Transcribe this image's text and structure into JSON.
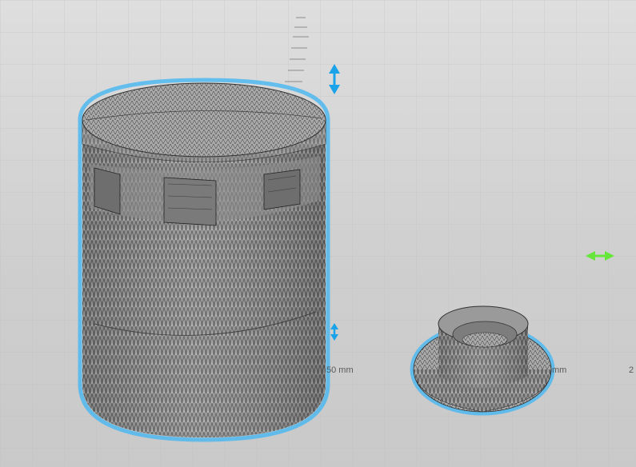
{
  "viewport": {
    "background": "#d6d6d6",
    "model_color": "#9a9a9a",
    "wire_color": "#2b2b2b",
    "selection_glow": "#4fb8f0"
  },
  "measurements": {
    "label_1": "50 mm",
    "label_2": "mm",
    "label_3": "2"
  },
  "gizmo": {
    "vertical_axis_color": "#1aa3e8",
    "horizontal_axis_color": "#66e63a"
  },
  "objects": [
    {
      "name": "large-cylinder-container"
    },
    {
      "name": "small-flanged-cap"
    }
  ]
}
